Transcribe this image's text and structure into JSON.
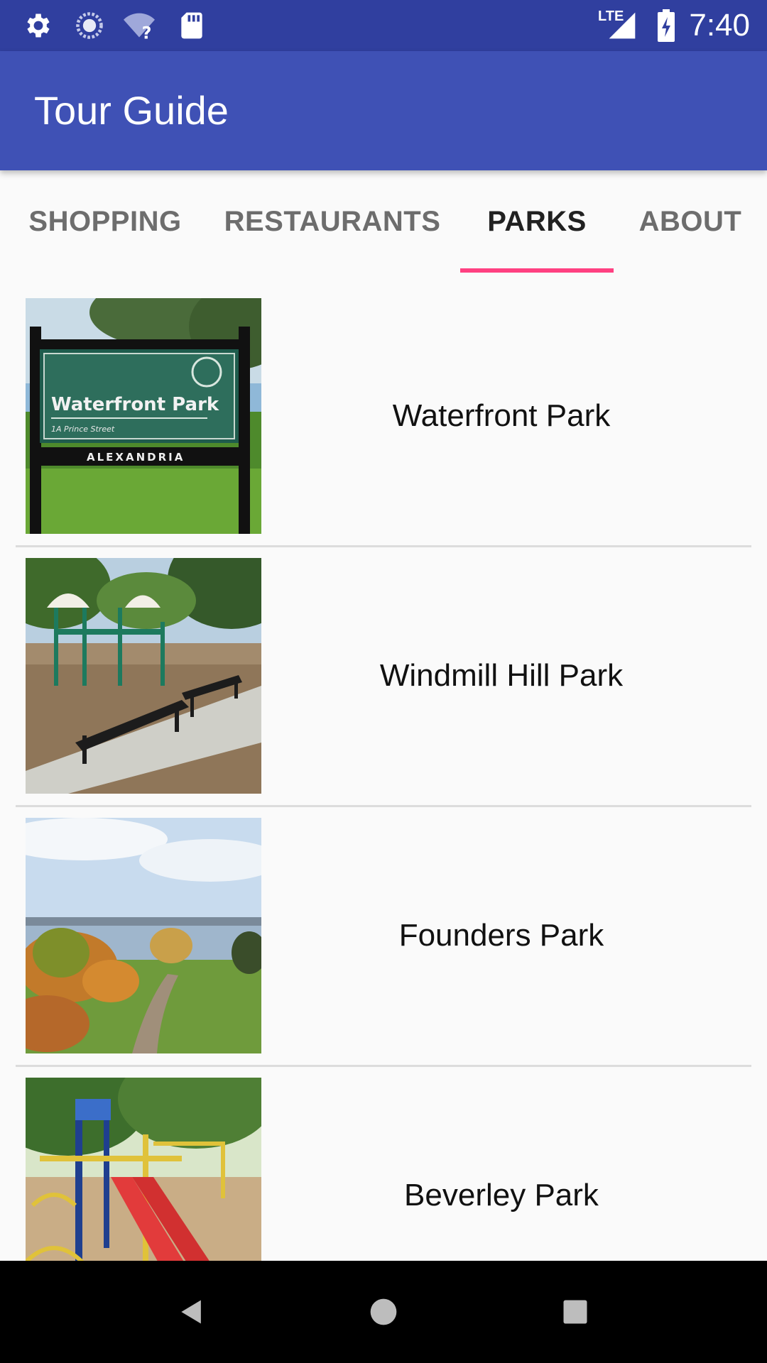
{
  "status_bar": {
    "time": "7:40",
    "network_label": "LTE",
    "icons": [
      "settings-icon",
      "sync-icon",
      "wifi-unknown-icon",
      "sd-card-icon",
      "signal-icon",
      "battery-charging-icon"
    ],
    "background_color": "#303f9f"
  },
  "app_bar": {
    "title": "Tour Guide",
    "background_color": "#3f51b5"
  },
  "tabs": {
    "items": [
      {
        "label": "SHOPPING",
        "active": false
      },
      {
        "label": "RESTAURANTS",
        "active": false
      },
      {
        "label": "PARKS",
        "active": true
      },
      {
        "label": "ABOUT",
        "active": false
      }
    ],
    "indicator_color": "#ff4081"
  },
  "parks": [
    {
      "name": "Waterfront Park",
      "image": "waterfront-park-sign-photo",
      "sign_title": "Waterfront Park",
      "sign_address": "1A Prince Street",
      "sign_footer": "ALEXANDRIA"
    },
    {
      "name": "Windmill Hill Park",
      "image": "playground-benches-photo"
    },
    {
      "name": "Founders Park",
      "image": "riverfront-lawn-photo"
    },
    {
      "name": "Beverley Park",
      "image": "playground-slide-photo"
    }
  ],
  "nav_bar": {
    "buttons": [
      "back-icon",
      "home-icon",
      "recents-icon"
    ]
  }
}
